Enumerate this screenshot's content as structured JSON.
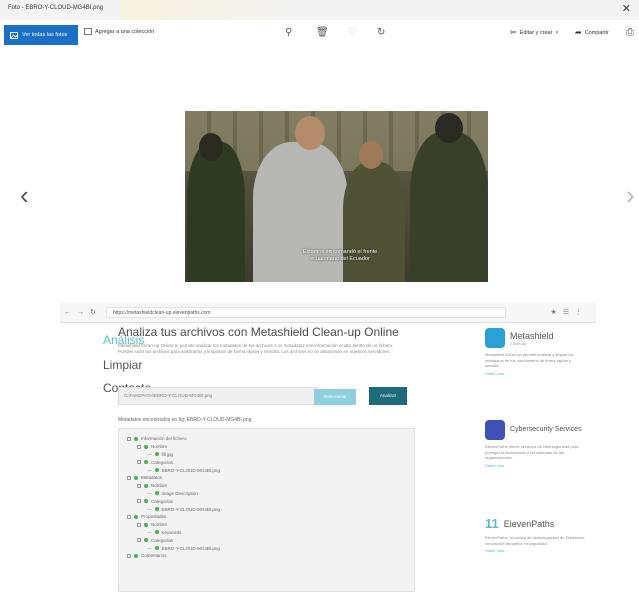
{
  "titlebar": {
    "tab_title": "Foto - EBRO-Y-CLOUD-MG4BI.png",
    "close_glyph": "✕"
  },
  "toolbar": {
    "view_all_label": "Ver todas las fotos",
    "add_label": "Agregar a una colección",
    "edit_label": "Editar y crear",
    "share_label": "Compartir",
    "zoom_icon": "zoom-icon",
    "delete_icon": "trash-icon",
    "favorite_icon": "heart-icon",
    "rotate_icon": "rotate-icon",
    "print_icon": "print-icon"
  },
  "viewer": {
    "prev_glyph": "‹",
    "next_glyph": "›",
    "caption_line1": "Estamos en comandó el frente",
    "caption_line2": "ecuatoriano del Ecuador"
  },
  "browser": {
    "url": "https://metashieldclean-up.elevenpaths.com",
    "nav_items": [
      "Análisis",
      "Limpiar",
      "Contacto"
    ],
    "heading": "Analiza tus archivos con Metashield Clean-up Online",
    "paragraph": "Metashield Clean-up Online te permite analizar los metadatos de tus archivos. Los metadatos son información oculta dentro de un fichero. Puedes subir tus archivos para analizarlos y limpiarlos de forma rápida y sencilla. Los archivos no se almacenan en nuestros servidores.",
    "file_value": "C:\\FAKEPATH\\EBRO-Y-CLOUD-MG4BI.png",
    "select_button": "Seleccionar",
    "analyze_button": "Analizar",
    "result_title": "Metadatos encontrados en fig: EBRO-Y-CLOUD-MG4BI.png",
    "tree": [
      {
        "level": 0,
        "kind": "box",
        "text": "Información del fichero"
      },
      {
        "level": 1,
        "kind": "dot",
        "text": "Nombre"
      },
      {
        "level": 2,
        "kind": "leaf",
        "text": "fill.jpg"
      },
      {
        "level": 1,
        "kind": "dot",
        "text": "Categorías"
      },
      {
        "level": 2,
        "kind": "leaf",
        "text": "EBRO-Y-CLOUD-MG4BI.png"
      },
      {
        "level": 0,
        "kind": "box",
        "text": "Metadatos"
      },
      {
        "level": 1,
        "kind": "dot",
        "text": "Nombre"
      },
      {
        "level": 2,
        "kind": "leaf",
        "text": "Image Description"
      },
      {
        "level": 1,
        "kind": "dot",
        "text": "Categorías"
      },
      {
        "level": 2,
        "kind": "leaf",
        "text": "EBRO-Y-CLOUD-MG4BI.png"
      },
      {
        "level": 0,
        "kind": "box",
        "text": "Propiedades"
      },
      {
        "level": 1,
        "kind": "dot",
        "text": "Nombre"
      },
      {
        "level": 2,
        "kind": "leaf",
        "text": "Keywords"
      },
      {
        "level": 1,
        "kind": "dot",
        "text": "Categorías"
      },
      {
        "level": 2,
        "kind": "leaf",
        "text": "EBRO-Y-CLOUD-MG4BI.png"
      },
      {
        "level": 0,
        "kind": "box",
        "text": "Comentarios"
      }
    ],
    "sidebar": [
      {
        "name": "Metashield",
        "sub": "Clean-up",
        "color": "#2a9fd6",
        "text": "Metashield Clean-up permite analizar y limpiar los metadatos de tus documentos de forma rápida y sencilla.",
        "link": "Saber más"
      },
      {
        "name": "Cybersecurity Services",
        "sub": "",
        "color": "#3f51b5",
        "text": "ElevenPaths ofrece servicios de ciberseguridad para proteger la información y los sistemas de las organizaciones.",
        "link": "Saber más"
      },
      {
        "name": "ElevenPaths",
        "sub": "",
        "color": "#5bbcd0",
        "text": "ElevenPaths, la unidad de ciberseguridad de Telefónica, innovación disruptiva en seguridad.",
        "link": "Saber más"
      }
    ]
  }
}
